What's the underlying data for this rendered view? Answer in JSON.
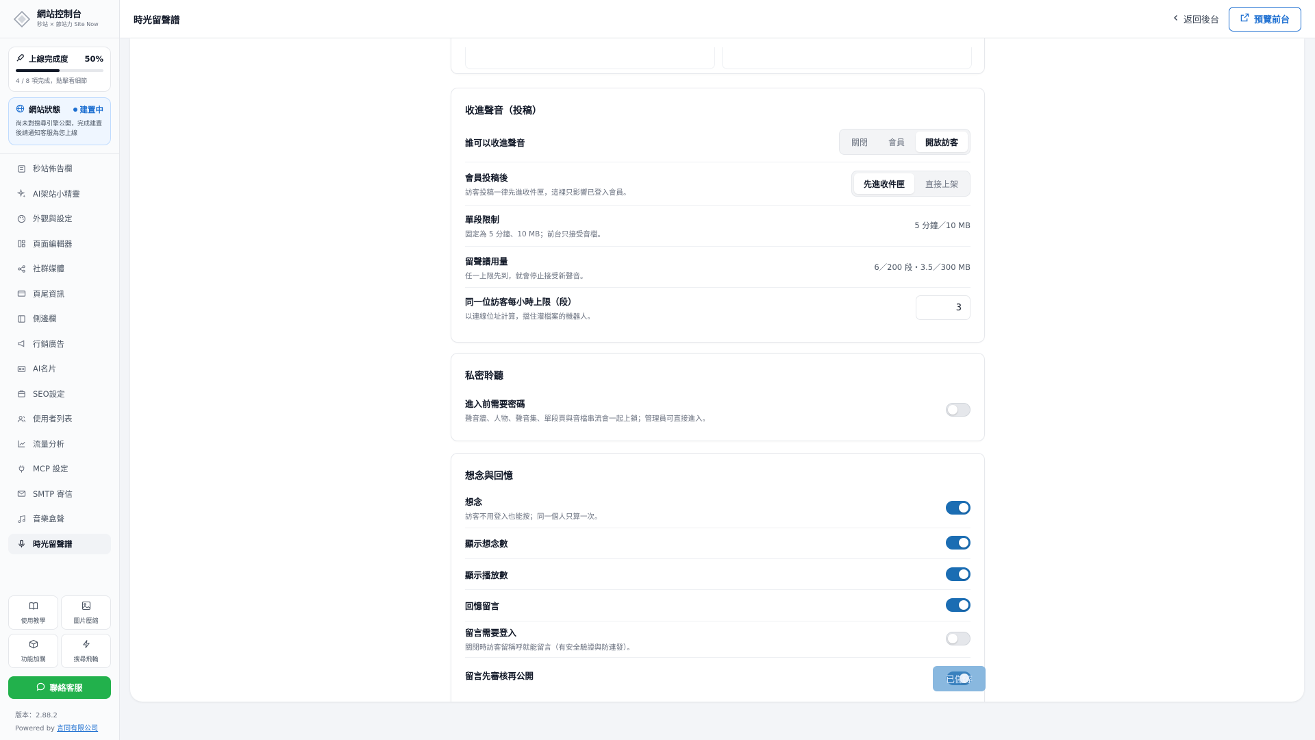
{
  "brand": {
    "title": "網站控制台",
    "subtitle": "秒站 × 節站力 Site Now"
  },
  "progress": {
    "label": "上線完成度",
    "percent_text": "50%",
    "fraction": 0.5,
    "note": "4 / 8 項完成，點擊看細節"
  },
  "site_status": {
    "label": "網站狀態",
    "badge": "建置中",
    "note": "尚未對搜尋引擎公開，完成建置後請通知客服為您上線"
  },
  "nav": [
    {
      "label": "秒站佈告欄",
      "icon": "bulletin-icon"
    },
    {
      "label": "AI架站小精靈",
      "icon": "sparkle-icon"
    },
    {
      "label": "外觀與設定",
      "icon": "palette-icon"
    },
    {
      "label": "頁面編輯器",
      "icon": "layout-icon"
    },
    {
      "label": "社群媒體",
      "icon": "share-icon"
    },
    {
      "label": "頁尾資訊",
      "icon": "card-icon"
    },
    {
      "label": "側邊欄",
      "icon": "sidebar-icon"
    },
    {
      "label": "行銷廣告",
      "icon": "megaphone-icon"
    },
    {
      "label": "AI名片",
      "icon": "id-card-icon"
    },
    {
      "label": "SEO設定",
      "icon": "seo-icon"
    },
    {
      "label": "使用者列表",
      "icon": "users-icon"
    },
    {
      "label": "流量分析",
      "icon": "chart-icon"
    },
    {
      "label": "MCP 設定",
      "icon": "plug-icon"
    },
    {
      "label": "SMTP 寄信",
      "icon": "mail-icon"
    },
    {
      "label": "音樂盒聲",
      "icon": "music-icon"
    },
    {
      "label": "時光留聲譜",
      "icon": "mic-icon",
      "active": true
    }
  ],
  "tiles": [
    {
      "label": "使用教學",
      "icon": "book-icon"
    },
    {
      "label": "圖片壓縮",
      "icon": "image-icon"
    },
    {
      "label": "功能加購",
      "icon": "box-icon"
    },
    {
      "label": "搜尋飛輪",
      "icon": "bolt-icon"
    }
  ],
  "support": {
    "label": "聯絡客服"
  },
  "version": {
    "text": "版本：2.88.2",
    "powered": "Powered by",
    "company": "言同有限公司"
  },
  "header": {
    "title": "時光留聲譜",
    "back": "返回後台",
    "preview": "預覽前台"
  },
  "submissions": {
    "title": "收進聲音（投稿）",
    "who": {
      "label": "誰可以收進聲音",
      "options": [
        "關閉",
        "會員",
        "開放訪客"
      ],
      "selected": "開放訪客"
    },
    "after_member": {
      "label": "會員投稿後",
      "desc": "訪客投稿一律先進收件匣，這裡只影響已登入會員。",
      "options": [
        "先進收件匣",
        "直接上架"
      ],
      "selected": "先進收件匣"
    },
    "limit": {
      "label": "單段限制",
      "desc": "固定為 5 分鐘、10 MB；前台只接受音檔。",
      "value": "5 分鐘／10 MB"
    },
    "usage": {
      "label": "留聲譜用量",
      "desc": "任一上限先到，就會停止接受新聲音。",
      "value": "6／200 段・3.5／300 MB"
    },
    "hourly": {
      "label": "同一位訪客每小時上限（段）",
      "desc": "以連線位址計算，擋住灌檔案的機器人。",
      "value": "3"
    }
  },
  "private": {
    "title": "私密聆聽",
    "password": {
      "label": "進入前需要密碼",
      "desc": "聲音牆、人物、聲音集、單段頁與音檔串流會一起上鎖；管理員可直接進入。",
      "on": false
    }
  },
  "memories": {
    "title": "想念與回憶",
    "miss": {
      "label": "想念",
      "desc": "訪客不用登入也能按；同一個人只算一次。",
      "on": true
    },
    "show_miss_count": {
      "label": "顯示想念數",
      "on": true
    },
    "show_play_count": {
      "label": "顯示播放數",
      "on": true
    },
    "memory_comments": {
      "label": "回憶留言",
      "on": true
    },
    "comment_login": {
      "label": "留言需要登入",
      "desc": "關閉時訪客留稱呼就能留言（有安全驗證與防連發）。",
      "on": false
    },
    "comment_review": {
      "label": "留言先審核再公開"
    }
  },
  "save_chip": {
    "label": "已儲存"
  },
  "colors": {
    "accent": "#1d6fd1",
    "toggle_on": "#1b6db3",
    "support": "#22b14c"
  }
}
